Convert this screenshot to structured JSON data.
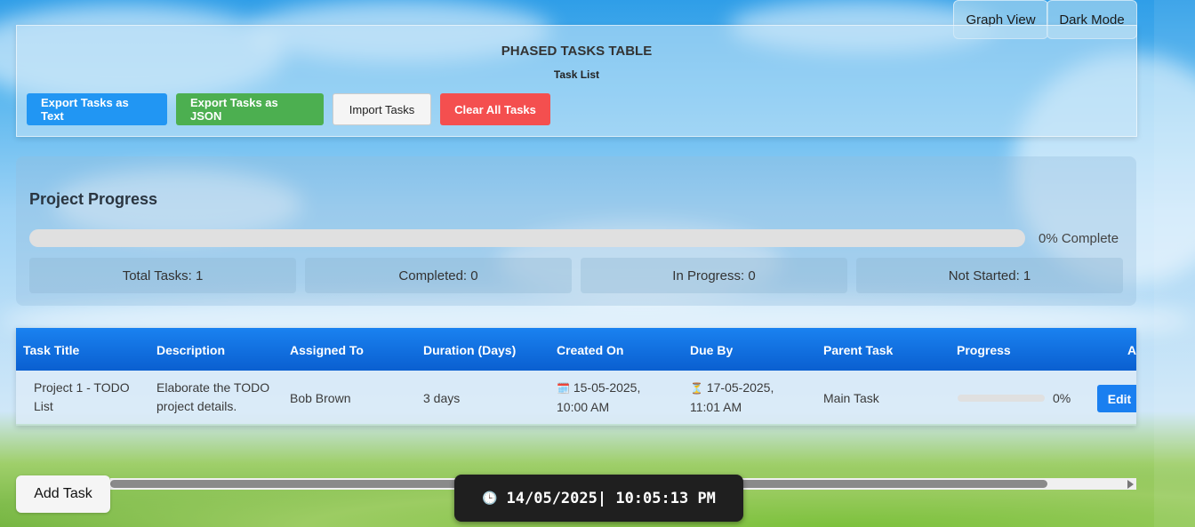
{
  "top_buttons": {
    "graph_view": "Graph View",
    "dark_mode": "Dark Mode"
  },
  "header": {
    "title": "PHASED TASKS TABLE",
    "subtitle": "Task List",
    "buttons": {
      "export_text": "Export Tasks as Text",
      "export_json": "Export Tasks as JSON",
      "import": "Import Tasks",
      "clear": "Clear All Tasks"
    }
  },
  "progress": {
    "title": "Project Progress",
    "percent_complete": 0,
    "percent_label": "0% Complete",
    "stats": {
      "total": "Total Tasks: 1",
      "completed": "Completed: 0",
      "in_progress": "In Progress: 0",
      "not_started": "Not Started: 1"
    }
  },
  "table": {
    "columns": [
      "Task Title",
      "Description",
      "Assigned To",
      "Duration (Days)",
      "Created On",
      "Due By",
      "Parent Task",
      "Progress",
      "A"
    ],
    "rows": [
      {
        "title_line1": "Project 1 - TODO",
        "title_line2": "List",
        "desc_line1": "Elaborate the TODO",
        "desc_line2": "project details.",
        "assigned": "Bob Brown",
        "duration": "3 days",
        "created_icon": "🗓️",
        "created_line1": "15-05-2025,",
        "created_line2": "10:00 AM",
        "due_icon": "⏳",
        "due_line1": "17-05-2025,",
        "due_line2": "11:01 AM",
        "parent": "Main Task",
        "progress_value": 0,
        "progress_label": "0%",
        "action": "Edit"
      }
    ]
  },
  "add_task": "Add Task",
  "clock": {
    "icon": "🕒",
    "text": "14/05/2025| 10:05:13 PM"
  },
  "colors": {
    "header_blue": "#0a5fd0",
    "export_text": "#2196f3",
    "export_json": "#4caf50",
    "clear": "#f44f4f",
    "edit": "#1a7ff0"
  }
}
